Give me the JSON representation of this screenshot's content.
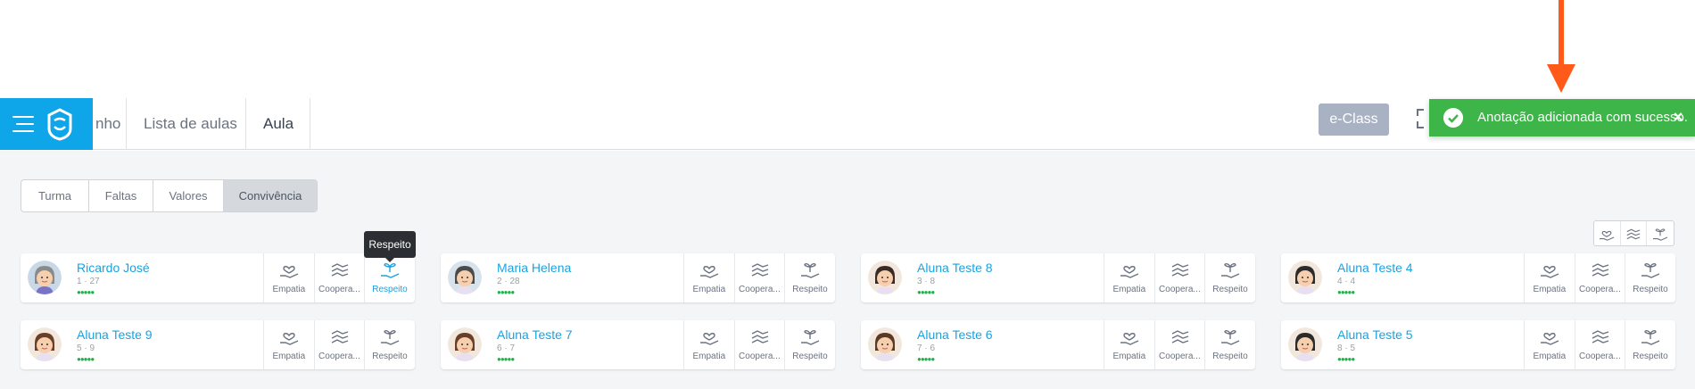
{
  "nav": {
    "partial_item": "nho",
    "lista_de_aulas": "Lista de aulas",
    "aula": "Aula",
    "eclass_button": "e-Class"
  },
  "toast": {
    "message": "Anotação adicionada com sucesso.",
    "close": "×",
    "color": "#3db548"
  },
  "tabs": [
    "Turma",
    "Faltas",
    "Valores",
    "Convivência"
  ],
  "active_tab": "Convivência",
  "tooltip": "Respeito",
  "value_labels": [
    "Empatia",
    "Coopera...",
    "Respeito"
  ],
  "students": [
    {
      "name": "Ricardo José",
      "nums": "1 · 27",
      "dots": "●●●●●"
    },
    {
      "name": "Maria Helena",
      "nums": "2 · 28",
      "dots": "●●●●●"
    },
    {
      "name": "Aluna Teste 8",
      "nums": "3 · 8",
      "dots": "●●●●●"
    },
    {
      "name": "Aluna Teste 4",
      "nums": "4 · 4",
      "dots": "●●●●●"
    },
    {
      "name": "Aluna Teste 9",
      "nums": "5 · 9",
      "dots": "●●●●●"
    },
    {
      "name": "Aluna Teste 7",
      "nums": "6 · 7",
      "dots": "●●●●●"
    },
    {
      "name": "Aluna Teste 6",
      "nums": "7 · 6",
      "dots": "●●●●●"
    },
    {
      "name": "Aluna Teste 5",
      "nums": "8 · 5",
      "dots": "●●●●●"
    }
  ],
  "colors": {
    "brand": "#0ea5e9",
    "link": "#1aa3e0",
    "arrow": "#ff5a1a"
  }
}
